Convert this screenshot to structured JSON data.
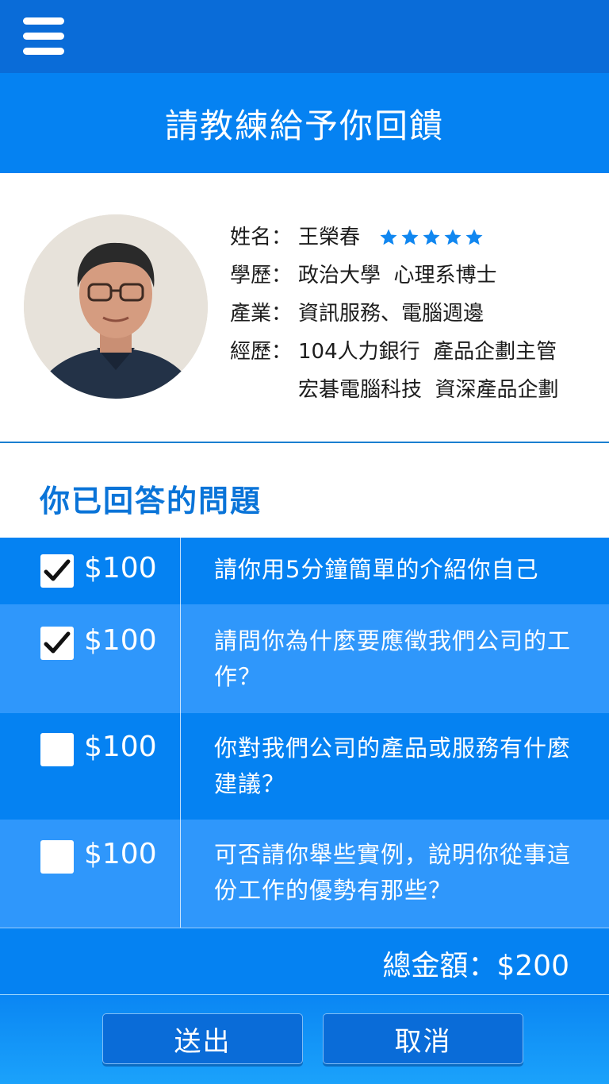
{
  "header": {
    "title": "請教練給予你回饋"
  },
  "coach": {
    "name_label": "姓名：",
    "name": "王榮春",
    "rating": 5,
    "education_label": "學歷：",
    "education": "政治大學  心理系博士",
    "industry_label": "產業：",
    "industry": "資訊服務、電腦週邊",
    "experience_label": "經歷：",
    "experience": [
      "104人力銀行  產品企劃主管",
      "宏碁電腦科技  資深產品企劃"
    ]
  },
  "section": {
    "title": "你已回答的問題"
  },
  "questions": [
    {
      "checked": true,
      "price": "$100",
      "text": "請你用5分鐘簡單的介紹你自己"
    },
    {
      "checked": true,
      "price": "$100",
      "text": "請問你為什麼要應徵我們公司的工作？"
    },
    {
      "checked": false,
      "price": "$100",
      "text": "你對我們公司的產品或服務有什麼建議？"
    },
    {
      "checked": false,
      "price": "$100",
      "text": "可否請你舉些實例，說明你從事這份工作的優勢有那些？"
    }
  ],
  "total": {
    "label": "總金額：$200"
  },
  "buttons": {
    "submit": "送出",
    "cancel": "取消"
  },
  "colors": {
    "primary": "#0582f2",
    "dark": "#0a6cd8",
    "light": "#2f97fb",
    "accent": "#0a74d8"
  }
}
